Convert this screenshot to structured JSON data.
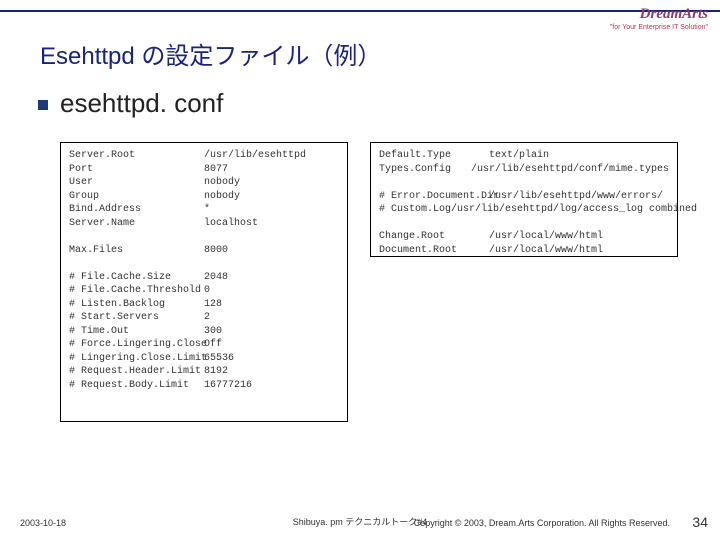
{
  "header": {
    "logo": "DreamArts",
    "tagline": "\"for Your Enterprise IT Solution\"",
    "title": "Esehttpd の設定ファイル（例）"
  },
  "subtitle": "esehttpd. conf",
  "left_block": {
    "rows1": [
      {
        "k": "Server.Root",
        "v": "/usr/lib/esehttpd"
      },
      {
        "k": "Port",
        "v": "8077"
      },
      {
        "k": "User",
        "v": "nobody"
      },
      {
        "k": "Group",
        "v": "nobody"
      },
      {
        "k": "Bind.Address",
        "v": "*"
      },
      {
        "k": "Server.Name",
        "v": "localhost"
      }
    ],
    "rows2": [
      {
        "k": "Max.Files",
        "v": "8000"
      }
    ],
    "rows3": [
      {
        "k": "# File.Cache.Size",
        "v": "2048"
      },
      {
        "k": "# File.Cache.Threshold",
        "v": "0"
      },
      {
        "k": "# Listen.Backlog",
        "v": "128"
      },
      {
        "k": "# Start.Servers",
        "v": "2"
      },
      {
        "k": "# Time.Out",
        "v": "300"
      },
      {
        "k": "# Force.Lingering.Close",
        "v": "Off"
      },
      {
        "k": "# Lingering.Close.Limit",
        "v": "65536"
      },
      {
        "k": "# Request.Header.Limit",
        "v": "8192"
      },
      {
        "k": "# Request.Body.Limit",
        "v": "16777216"
      }
    ]
  },
  "right_block": {
    "rows1": [
      {
        "k": "Default.Type",
        "v": "text/plain"
      },
      {
        "k": "Types.Config",
        "v": "/usr/lib/esehttpd/conf/mime.types"
      }
    ],
    "rows2": [
      {
        "k": "# Error.Document.Dir",
        "v": "/usr/lib/esehttpd/www/errors/"
      },
      {
        "k": "# Custom.Log",
        "v": "/usr/lib/esehttpd/log/access_log combined"
      }
    ],
    "rows3": [
      {
        "k": "Change.Root",
        "v": "/usr/local/www/html"
      },
      {
        "k": "Document.Root",
        "v": "/usr/local/www/html"
      }
    ]
  },
  "footer": {
    "date": "2003-10-18",
    "center": "Shibuya. pm テクニカルトーク#4",
    "right": "Copyright © 2003, Dream.Arts Corporation. All Rights Reserved.",
    "page": "34"
  }
}
